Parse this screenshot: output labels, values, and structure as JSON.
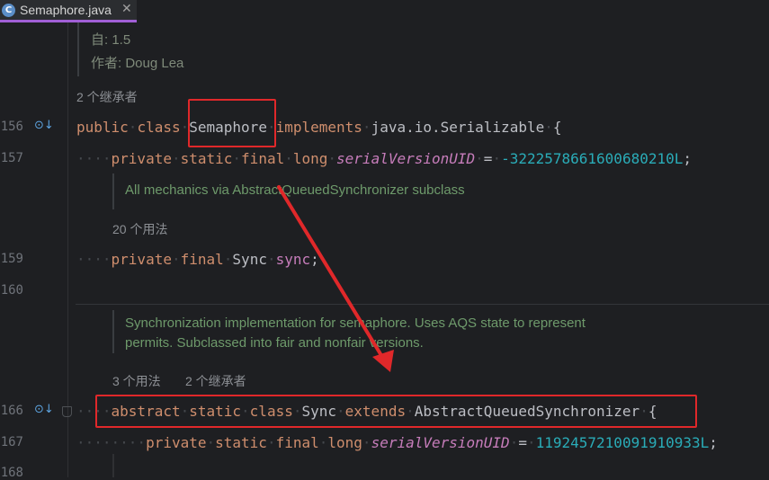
{
  "tab": {
    "label": "Semaphore.java",
    "icon_letter": "C",
    "close_glyph": "✕"
  },
  "doc_header": {
    "since": "自:     1.5",
    "author": "作者: Doug Lea"
  },
  "hints": {
    "inheritors_1": "2 个继承者",
    "usages_sync": "20 个用法",
    "usages_3": "3 个用法",
    "inheritors_2": "2 个继承者"
  },
  "lines": {
    "n156": "156",
    "n157": "157",
    "n159": "159",
    "n160": "160",
    "n166": "166",
    "n167": "167",
    "n168": "168"
  },
  "code": {
    "l156": {
      "kw_public": "public",
      "kw_class": "class",
      "name": "Semaphore",
      "kw_implements": "implements",
      "type": "java.io.Serializable",
      "brace": "{"
    },
    "l157": {
      "kw_private": "private",
      "kw_static": "static",
      "kw_final": "final",
      "kw_long": "long",
      "field": "serialVersionUID",
      "eq": "=",
      "value": "-3222578661600680210L",
      "semi": ";"
    },
    "l159": {
      "kw_private": "private",
      "kw_final": "final",
      "type": "Sync",
      "field": "sync",
      "semi": ";"
    },
    "l166": {
      "kw_abstract": "abstract",
      "kw_static": "static",
      "kw_class": "class",
      "name": "Sync",
      "kw_extends": "extends",
      "type": "AbstractQueuedSynchronizer",
      "brace": "{"
    },
    "l167": {
      "kw_private": "private",
      "kw_static": "static",
      "kw_final": "final",
      "kw_long": "long",
      "field": "serialVersionUID",
      "eq": "=",
      "value": "1192457210091910933L",
      "semi": ";"
    }
  },
  "docs": {
    "sync_field": "All mechanics via AbstractQueuedSynchronizer subclass",
    "sync_class_1": "Synchronization implementation for semaphore. Uses AQS state to represent",
    "sync_class_2": "permits. Subclassed into fair and nonfair versions."
  },
  "colors": {
    "background": "#1e1f22",
    "keyword": "#cf8e6d",
    "field": "#c77dbb",
    "number": "#2aacb8",
    "doc_comment": "#6e9a6b",
    "annotation_red": "#e0282a",
    "tab_underline": "#a15fd6"
  },
  "icons": {
    "file_type": "java-class-icon",
    "implemented": "implemented-by-icon",
    "fold": "fold-marker-icon"
  }
}
